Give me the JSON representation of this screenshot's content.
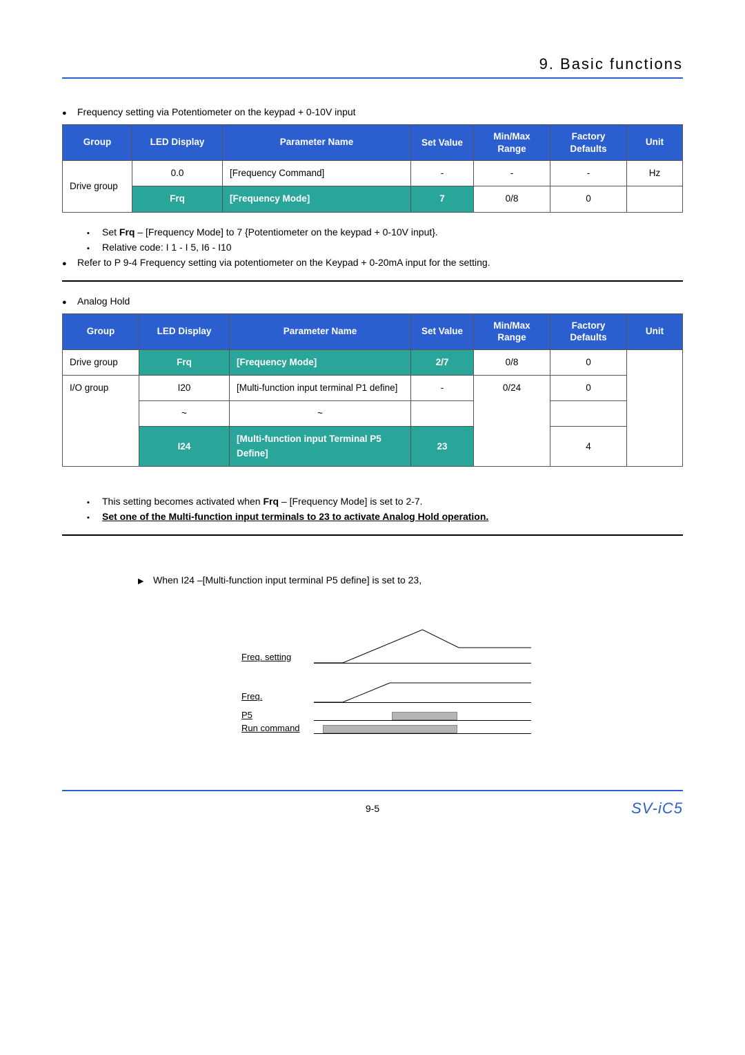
{
  "chapter_title": "9. Basic functions",
  "section1_title": "Frequency setting via Potentiometer on the keypad + 0-10V input",
  "headers": {
    "group": "Group",
    "led": "LED Display",
    "param": "Parameter Name",
    "setval": "Set Value",
    "range": "Min/Max Range",
    "defaults": "Factory Defaults",
    "unit": "Unit"
  },
  "t1": {
    "r1_group": "Drive group",
    "r1_led": "0.0",
    "r1_param": "[Frequency Command]",
    "r1_set": "-",
    "r1_range": "-",
    "r1_def": "-",
    "r1_unit": "Hz",
    "r2_led": "Frq",
    "r2_param": "[Frequency Mode]",
    "r2_set": "7",
    "r2_range": "0/8",
    "r2_def": "0"
  },
  "notes1": {
    "a_pre": "Set ",
    "a_b": "Frq",
    "a_post": " – [Frequency Mode] to 7 {Potentiometer on the keypad + 0-10V input}.",
    "b": "Relative code: I 1 - I 5, I6 - I10",
    "c": "Refer to P 9-4 Frequency setting via potentiometer on the Keypad + 0-20mA input for the setting."
  },
  "section2_title": "Analog Hold",
  "t2": {
    "r1_group": "Drive group",
    "r1_led": "Frq",
    "r1_param": "[Frequency Mode]",
    "r1_set": "2/7",
    "r1_range": "0/8",
    "r1_def": "0",
    "r2_group": "I/O group",
    "r2_led": "I20",
    "r2_param": "[Multi-function input terminal P1 define]",
    "r2_set": "-",
    "r2_range": "0/24",
    "r2_def": "0",
    "r3_led": "~",
    "r3_param": "~",
    "r4_led": "I24",
    "r4_param": "[Multi-function input Terminal P5 Define]",
    "r4_set": "23",
    "r4_def": "4"
  },
  "notes2": {
    "a_pre": "This setting becomes activated when ",
    "a_b": "Frq",
    "a_post": " – [Frequency Mode] is set to 2-7.",
    "b": "Set one of the Multi-function input terminals to 23 to activate Analog Hold operation."
  },
  "note3": "When I24 –[Multi-function input terminal P5 define] is set to 23,",
  "diag": {
    "freq_setting": "Freq. setting",
    "freq": "Freq.",
    "p5": "P5",
    "run": "Run command"
  },
  "footer": {
    "pageno": "9-5",
    "product": "SV-iC5"
  }
}
